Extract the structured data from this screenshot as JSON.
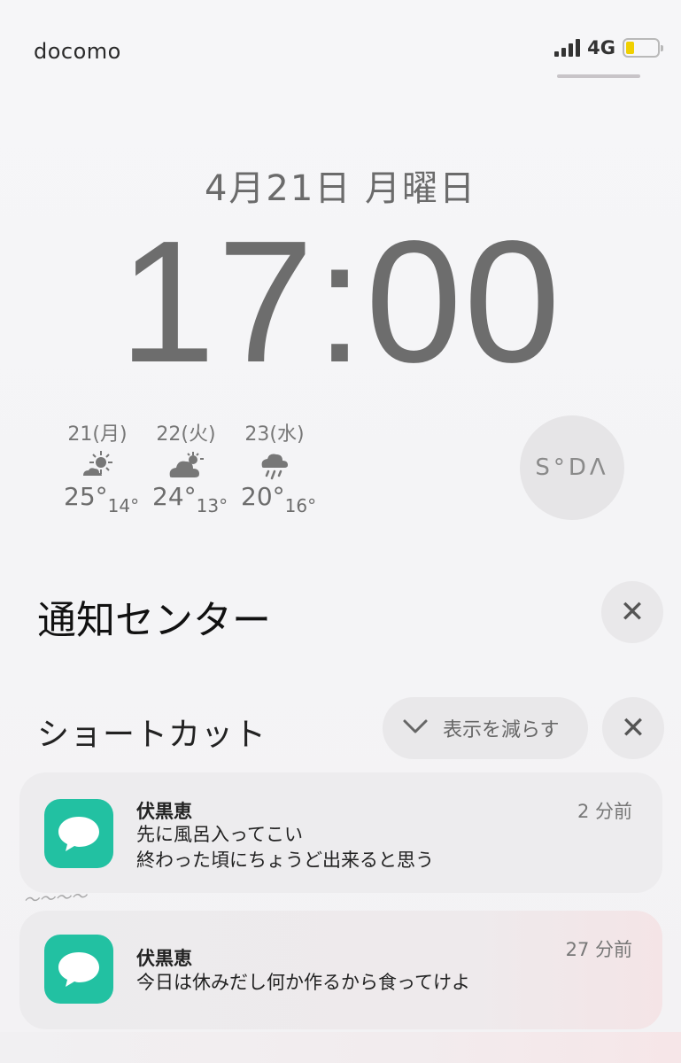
{
  "status_bar": {
    "carrier": "docomo",
    "network": "4G",
    "battery_level": 0.25,
    "battery_color": "#f0d000"
  },
  "lock_screen": {
    "date": "4月21日 月曜日",
    "time": "17:00"
  },
  "weather": [
    {
      "label": "21(月)",
      "icon": "sun-with-cloud-icon",
      "high": "25°",
      "low": "14°"
    },
    {
      "label": "22(火)",
      "icon": "cloud-with-sun-icon",
      "high": "24°",
      "low": "13°"
    },
    {
      "label": "23(水)",
      "icon": "rain-cloud-icon",
      "high": "20°",
      "low": "16°"
    }
  ],
  "widget": {
    "logo_text": "S°DΛ"
  },
  "notification_center": {
    "title": "通知センター",
    "clear_icon": "close-icon",
    "shortcut_title": "ショートカット",
    "show_less_label": "表示を減らす"
  },
  "notifications": [
    {
      "app_icon": "message-bubble-icon",
      "accent": "#22c1a2",
      "sender": "伏黒恵",
      "time": "2 分前",
      "lines": [
        "先に風呂入ってこい",
        "終わった頃にちょうど出来ると思う"
      ]
    },
    {
      "app_icon": "message-bubble-icon",
      "accent": "#22c1a2",
      "sender": "伏黒恵",
      "time": "27 分前",
      "lines": [
        "今日は休みだし何か作るから食ってけよ"
      ]
    }
  ]
}
